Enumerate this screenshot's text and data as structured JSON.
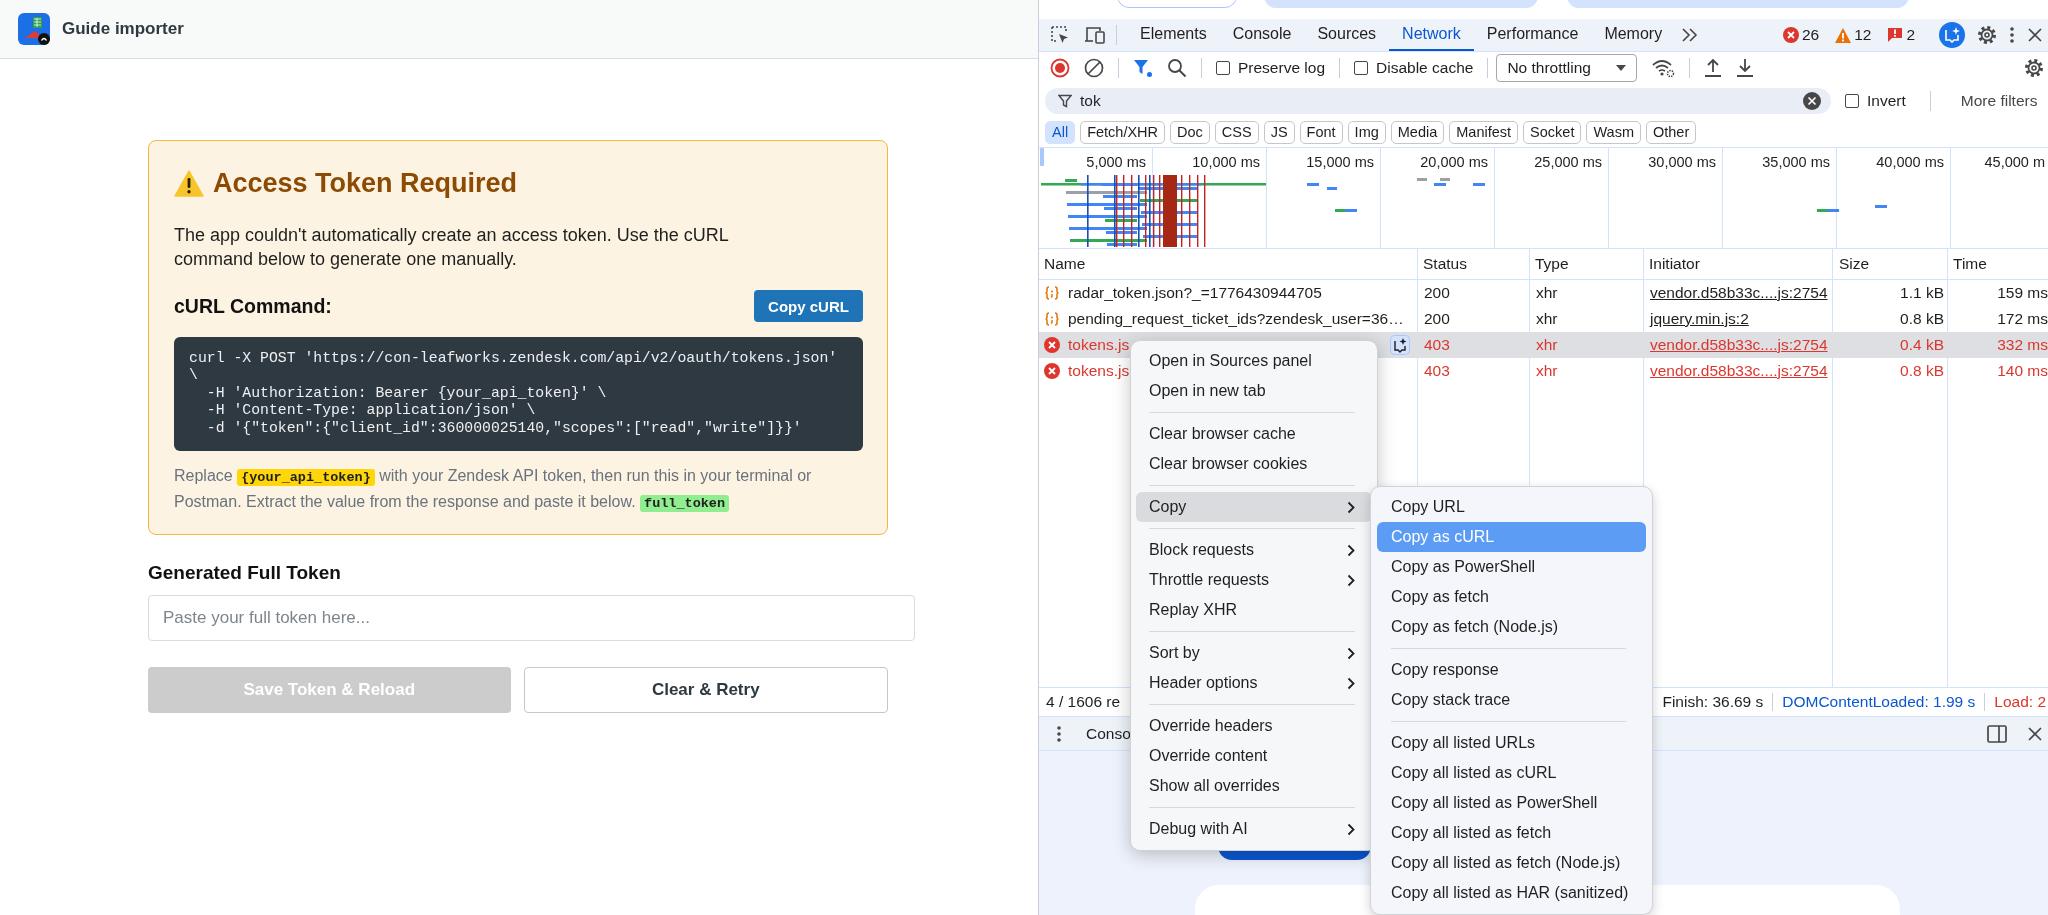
{
  "page_header": {
    "title": "Guide importer"
  },
  "alert": {
    "title": "Access Token Required",
    "description": "The app couldn't automatically create an access token. Use the cURL command below to generate one manually.",
    "command_heading": "cURL Command:",
    "copy_button": "Copy cURL",
    "command_lines": [
      "curl -X POST 'https://con-leafworks.zendesk.com/api/v2/oauth/tokens.json'",
      "\\",
      "  -H 'Authorization: Bearer {your_api_token}' \\",
      "  -H 'Content-Type: application/json' \\",
      "  -d '{\"token\":{\"client_id\":360000025140,\"scopes\":[\"read\",\"write\"]}}'"
    ],
    "note": [
      {
        "kind": "text",
        "text": "Replace "
      },
      {
        "kind": "code",
        "text": "{your_api_token}",
        "color": "#ffd60a"
      },
      {
        "kind": "text",
        "text": " with your Zendesk API token, then run this in your terminal or Postman. Extract the value from the response and paste it below. "
      },
      {
        "kind": "code",
        "text": "full_token",
        "color": "#90ee90"
      }
    ]
  },
  "token_form": {
    "label": "Generated Full Token",
    "placeholder": "Paste your full token here...",
    "buttons": [
      {
        "label": "Save Token & Reload",
        "kind": "primary",
        "disabled": true
      },
      {
        "label": "Clear & Retry",
        "kind": "secondary",
        "disabled": false
      }
    ]
  },
  "devtools": {
    "tabs": [
      {
        "label": "Elements",
        "selected": false
      },
      {
        "label": "Console",
        "selected": false
      },
      {
        "label": "Sources",
        "selected": false
      },
      {
        "label": "Network",
        "selected": true
      },
      {
        "label": "Performance",
        "selected": false
      },
      {
        "label": "Memory",
        "selected": false
      }
    ],
    "counters": [
      {
        "kind": "error",
        "count": "26"
      },
      {
        "kind": "warning",
        "count": "12"
      },
      {
        "kind": "issue",
        "count": "2"
      }
    ],
    "toolbar": {
      "checkboxes": [
        {
          "label": "Preserve log",
          "checked": false
        },
        {
          "label": "Disable cache",
          "checked": false
        }
      ],
      "throttling": "No throttling"
    },
    "filter": {
      "value": "tok",
      "invert": {
        "label": "Invert",
        "checked": false
      },
      "more_filters": "More filters"
    },
    "type_filters": [
      {
        "label": "All",
        "selected": true
      },
      {
        "label": "Fetch/XHR",
        "selected": false
      },
      {
        "label": "Doc",
        "selected": false
      },
      {
        "label": "CSS",
        "selected": false
      },
      {
        "label": "JS",
        "selected": false
      },
      {
        "label": "Font",
        "selected": false
      },
      {
        "label": "Img",
        "selected": false
      },
      {
        "label": "Media",
        "selected": false
      },
      {
        "label": "Manifest",
        "selected": false
      },
      {
        "label": "Socket",
        "selected": false
      },
      {
        "label": "Wasm",
        "selected": false
      },
      {
        "label": "Other",
        "selected": false
      }
    ],
    "overview": {
      "ticks": [
        "5,000 ms",
        "10,000 ms",
        "15,000 ms",
        "20,000 ms",
        "25,000 ms",
        "30,000 ms",
        "35,000 ms",
        "40,000 ms",
        "45,000 m"
      ]
    },
    "table": {
      "columns": [
        "Name",
        "Status",
        "Type",
        "Initiator",
        "Size",
        "Time"
      ],
      "rows": [
        {
          "name": "radar_token.json?_=1776430944705",
          "status": "200",
          "type": "xhr",
          "initiator": "vendor.d58b33c....js:2754",
          "size": "1.1 kB",
          "time": "159 ms",
          "failed": false,
          "selected": false
        },
        {
          "name": "pending_request_ticket_ids?zendesk_user=36…",
          "status": "200",
          "type": "xhr",
          "initiator": "jquery.min.js:2",
          "size": "0.8 kB",
          "time": "172 ms",
          "failed": false,
          "selected": false
        },
        {
          "name": "tokens.js",
          "status": "403",
          "type": "xhr",
          "initiator": "vendor.d58b33c....js:2754",
          "size": "0.4 kB",
          "time": "332 ms",
          "failed": true,
          "selected": true
        },
        {
          "name": "tokens.js",
          "status": "403",
          "type": "xhr",
          "initiator": "vendor.d58b33c....js:2754",
          "size": "0.8 kB",
          "time": "140 ms",
          "failed": true,
          "selected": false
        }
      ]
    },
    "status_bar": {
      "requests": "4 / 1606 re",
      "finish": "Finish: 36.69 s",
      "dom_content_loaded": "DOMContentLoaded: 1.99 s",
      "load": "Load: 2"
    },
    "drawer": {
      "tab": "Conso"
    }
  },
  "context_menu": {
    "groups": [
      [
        {
          "label": "Open in Sources panel",
          "submenu": false,
          "selected": false
        },
        {
          "label": "Open in new tab",
          "submenu": false,
          "selected": false
        }
      ],
      [
        {
          "label": "Clear browser cache",
          "submenu": false,
          "selected": false
        },
        {
          "label": "Clear browser cookies",
          "submenu": false,
          "selected": false
        }
      ],
      [
        {
          "label": "Copy",
          "submenu": true,
          "selected": true
        }
      ],
      [
        {
          "label": "Block requests",
          "submenu": true,
          "selected": false
        },
        {
          "label": "Throttle requests",
          "submenu": true,
          "selected": false
        },
        {
          "label": "Replay XHR",
          "submenu": false,
          "selected": false
        }
      ],
      [
        {
          "label": "Sort by",
          "submenu": true,
          "selected": false
        },
        {
          "label": "Header options",
          "submenu": true,
          "selected": false
        }
      ],
      [
        {
          "label": "Override headers",
          "submenu": false,
          "selected": false
        },
        {
          "label": "Override content",
          "submenu": false,
          "selected": false
        },
        {
          "label": "Show all overrides",
          "submenu": false,
          "selected": false
        }
      ],
      [
        {
          "label": "Debug with AI",
          "submenu": true,
          "selected": false
        }
      ]
    ]
  },
  "copy_submenu": {
    "groups": [
      [
        {
          "label": "Copy URL",
          "selected": false
        },
        {
          "label": "Copy as cURL",
          "selected": true
        },
        {
          "label": "Copy as PowerShell",
          "selected": false
        },
        {
          "label": "Copy as fetch",
          "selected": false
        },
        {
          "label": "Copy as fetch (Node.js)",
          "selected": false
        }
      ],
      [
        {
          "label": "Copy response",
          "selected": false
        },
        {
          "label": "Copy stack trace",
          "selected": false
        }
      ],
      [
        {
          "label": "Copy all listed URLs",
          "selected": false
        },
        {
          "label": "Copy all listed as cURL",
          "selected": false
        },
        {
          "label": "Copy all listed as PowerShell",
          "selected": false
        },
        {
          "label": "Copy all listed as fetch",
          "selected": false
        },
        {
          "label": "Copy all listed as fetch (Node.js)",
          "selected": false
        },
        {
          "label": "Copy all listed as HAR (sanitized)",
          "selected": false
        }
      ]
    ]
  }
}
